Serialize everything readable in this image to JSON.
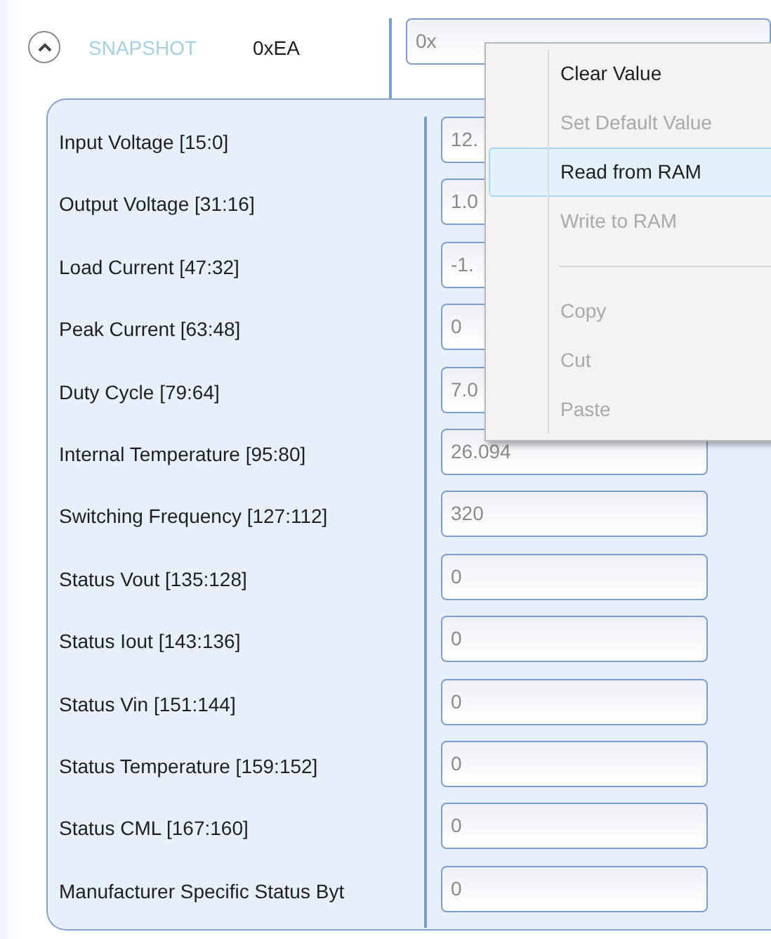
{
  "header": {
    "expanded": true,
    "title": "SNAPSHOT",
    "code": "0xEA",
    "value": "0x"
  },
  "fields": [
    {
      "label": "Input Voltage [15:0]",
      "value": "12."
    },
    {
      "label": "Output Voltage [31:16]",
      "value": "1.0"
    },
    {
      "label": "Load Current [47:32]",
      "value": "-1."
    },
    {
      "label": "Peak Current [63:48]",
      "value": "0"
    },
    {
      "label": "Duty Cycle [79:64]",
      "value": "7.0"
    },
    {
      "label": "Internal Temperature [95:80]",
      "value": "26.094"
    },
    {
      "label": "Switching Frequency [127:112]",
      "value": "320"
    },
    {
      "label": "Status Vout [135:128]",
      "value": "0"
    },
    {
      "label": "Status Iout [143:136]",
      "value": "0"
    },
    {
      "label": "Status Vin [151:144]",
      "value": "0"
    },
    {
      "label": "Status Temperature [159:152]",
      "value": "0"
    },
    {
      "label": "Status CML [167:160]",
      "value": "0"
    },
    {
      "label": "Manufacturer Specific Status Byt",
      "value": "0"
    }
  ],
  "context_menu": {
    "items": [
      {
        "kind": "item",
        "label": "Clear Value",
        "disabled": false,
        "selected": false
      },
      {
        "kind": "item",
        "label": "Set Default Value",
        "disabled": true,
        "selected": false
      },
      {
        "kind": "item",
        "label": "Read from RAM",
        "disabled": false,
        "selected": true
      },
      {
        "kind": "item",
        "label": "Write to RAM",
        "disabled": true,
        "selected": false
      },
      {
        "kind": "separator"
      },
      {
        "kind": "item",
        "label": "Copy",
        "disabled": true,
        "selected": false
      },
      {
        "kind": "item",
        "label": "Cut",
        "disabled": true,
        "selected": false
      },
      {
        "kind": "item",
        "label": "Paste",
        "disabled": true,
        "selected": false
      }
    ]
  }
}
